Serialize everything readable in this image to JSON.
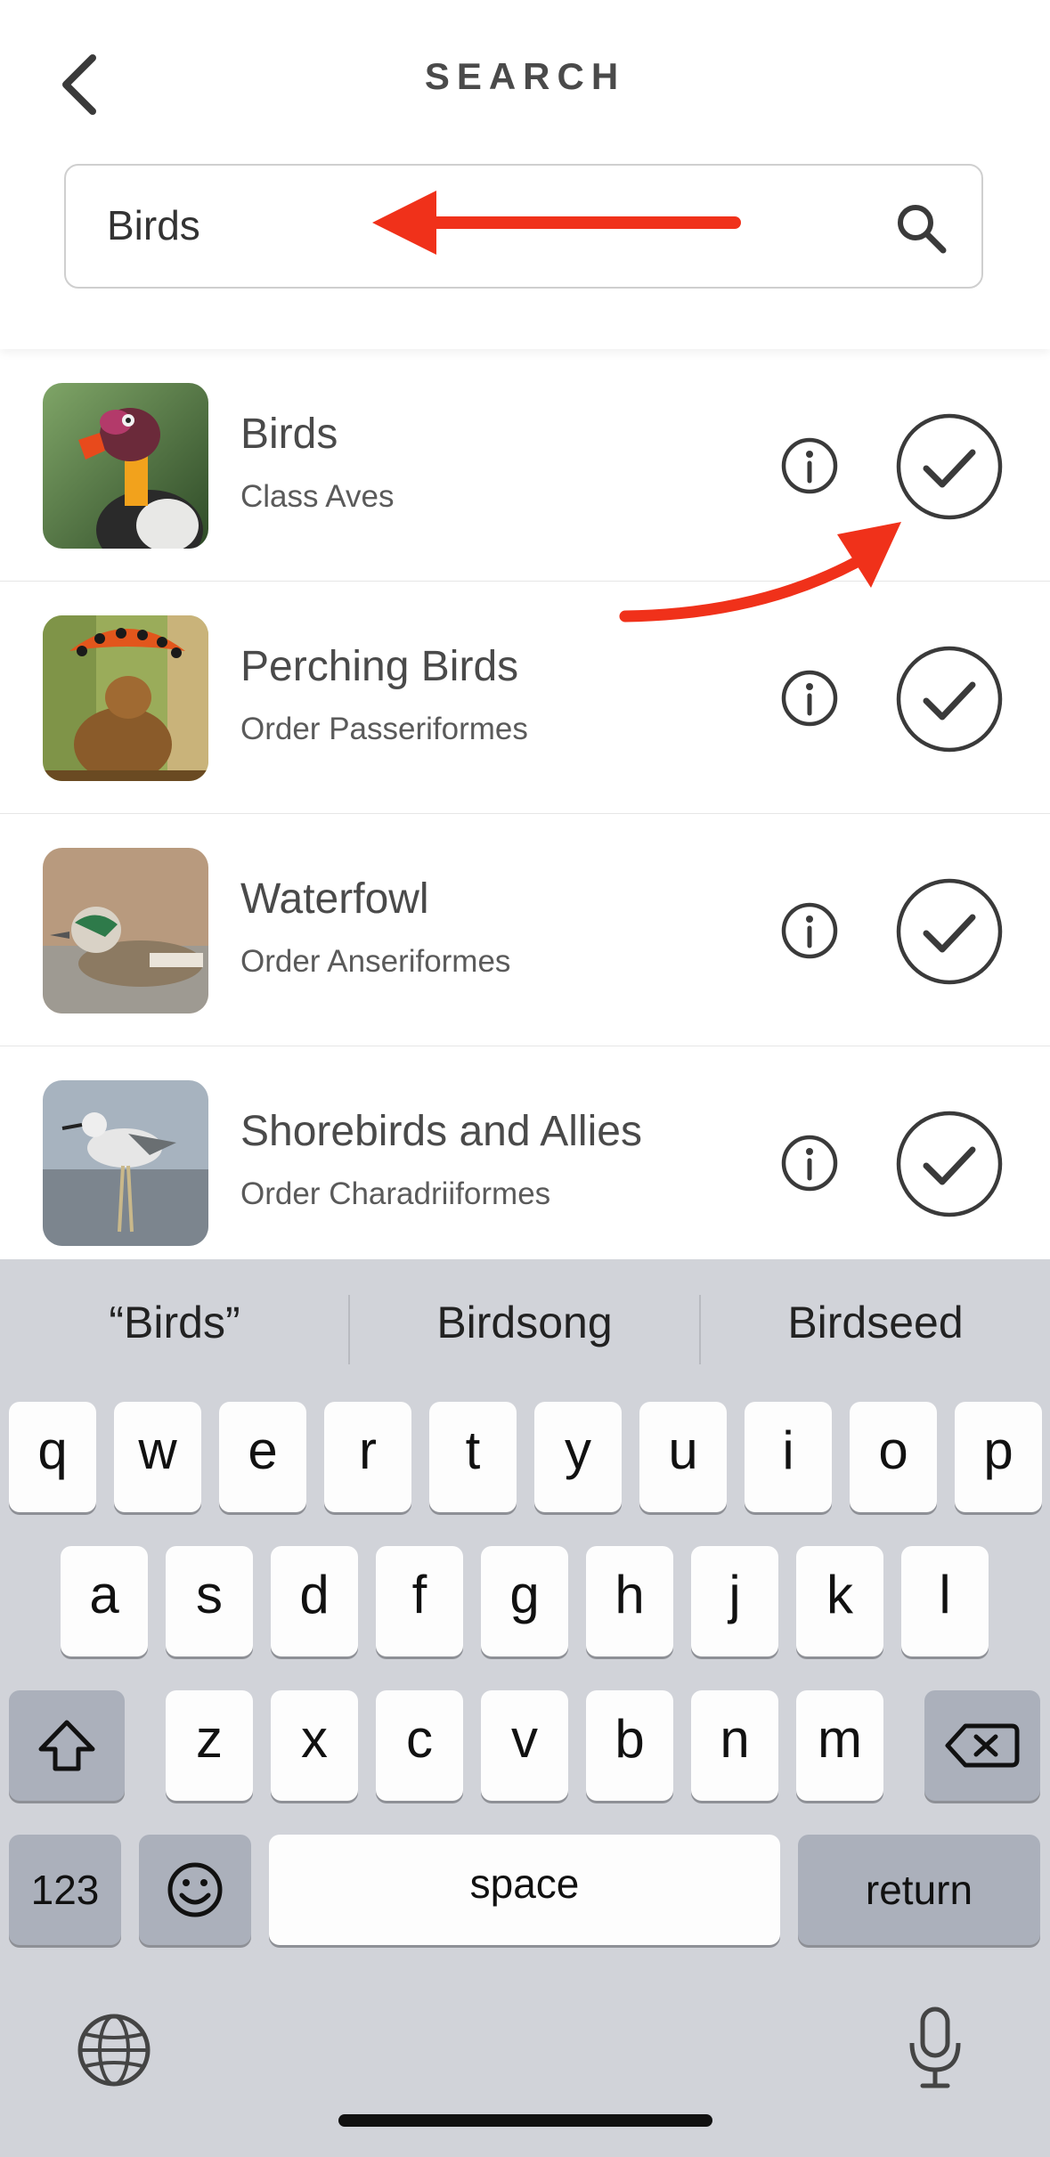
{
  "header": {
    "title": "SEARCH"
  },
  "search": {
    "value": "Birds",
    "placeholder": ""
  },
  "results": [
    {
      "name": "Birds",
      "rank": "Class Aves"
    },
    {
      "name": "Perching Birds",
      "rank": "Order Passeriformes"
    },
    {
      "name": "Waterfowl",
      "rank": "Order Anseriformes"
    },
    {
      "name": "Shorebirds and Allies",
      "rank": "Order Charadriiformes"
    }
  ],
  "keyboard": {
    "suggestions": [
      "“Birds”",
      "Birdsong",
      "Birdseed"
    ],
    "row1": [
      "q",
      "w",
      "e",
      "r",
      "t",
      "y",
      "u",
      "i",
      "o",
      "p"
    ],
    "row2": [
      "a",
      "s",
      "d",
      "f",
      "g",
      "h",
      "j",
      "k",
      "l"
    ],
    "row3": [
      "z",
      "x",
      "c",
      "v",
      "b",
      "n",
      "m"
    ],
    "numbers_label": "123",
    "space_label": "space",
    "return_label": "return"
  },
  "colors": {
    "annotation_arrow": "#f0311a",
    "text_primary": "#4a4a4a",
    "keyboard_bg": "#d1d3d9"
  }
}
